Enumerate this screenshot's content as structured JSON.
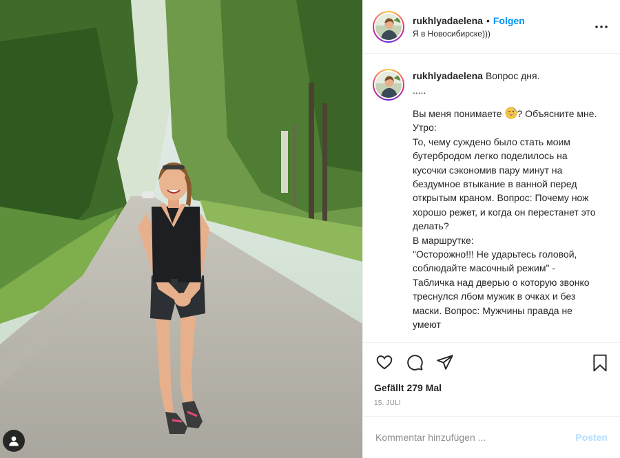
{
  "colors": {
    "accent": "#0095f6",
    "post_disabled": "#b2dffc",
    "text": "#262626",
    "muted": "#8e8e8e",
    "divider": "#efefef"
  },
  "header": {
    "username": "rukhlyadaelena",
    "separator": "•",
    "follow_label": "Folgen",
    "location": "Я в Новосибирске)))",
    "more_icon": "more-horizontal-icon"
  },
  "caption": {
    "username": "rukhlyadaelena",
    "lines": {
      "title": "Вопрос дня.",
      "dots": ".....",
      "l1a": "Вы меня понимаете ",
      "l1b": "? Объясните мне.",
      "l2": "Утро:",
      "l3": "То, чему суждено было стать моим бутербродом легко поделилось на кусочки сэкономив пару минут на бездумное втыкание в ванной перед открытым краном. Вопрос: Почему нож хорошо режет, и когда он перестанет это делать?",
      "l4": "В маршрутке:",
      "l5": "\"Осторожно!!! Не ударьтесь головой, соблюдайте масочный режим\" - Табличка над дверью о которую звонко треснулся лбом мужик в очках и без маски. Вопрос: Мужчины правда не умеют"
    },
    "emoji": "grinning-sweat-emoji"
  },
  "actions": {
    "like_icon": "heart-icon",
    "comment_icon": "comment-icon",
    "share_icon": "share-icon",
    "save_icon": "bookmark-icon"
  },
  "likes_text": "Gefällt 279 Mal",
  "date": "15. JULI",
  "comment": {
    "placeholder": "Kommentar hinzufügen ...",
    "post_label": "Posten"
  },
  "photo": {
    "user_tag_icon": "user-tag-icon"
  }
}
